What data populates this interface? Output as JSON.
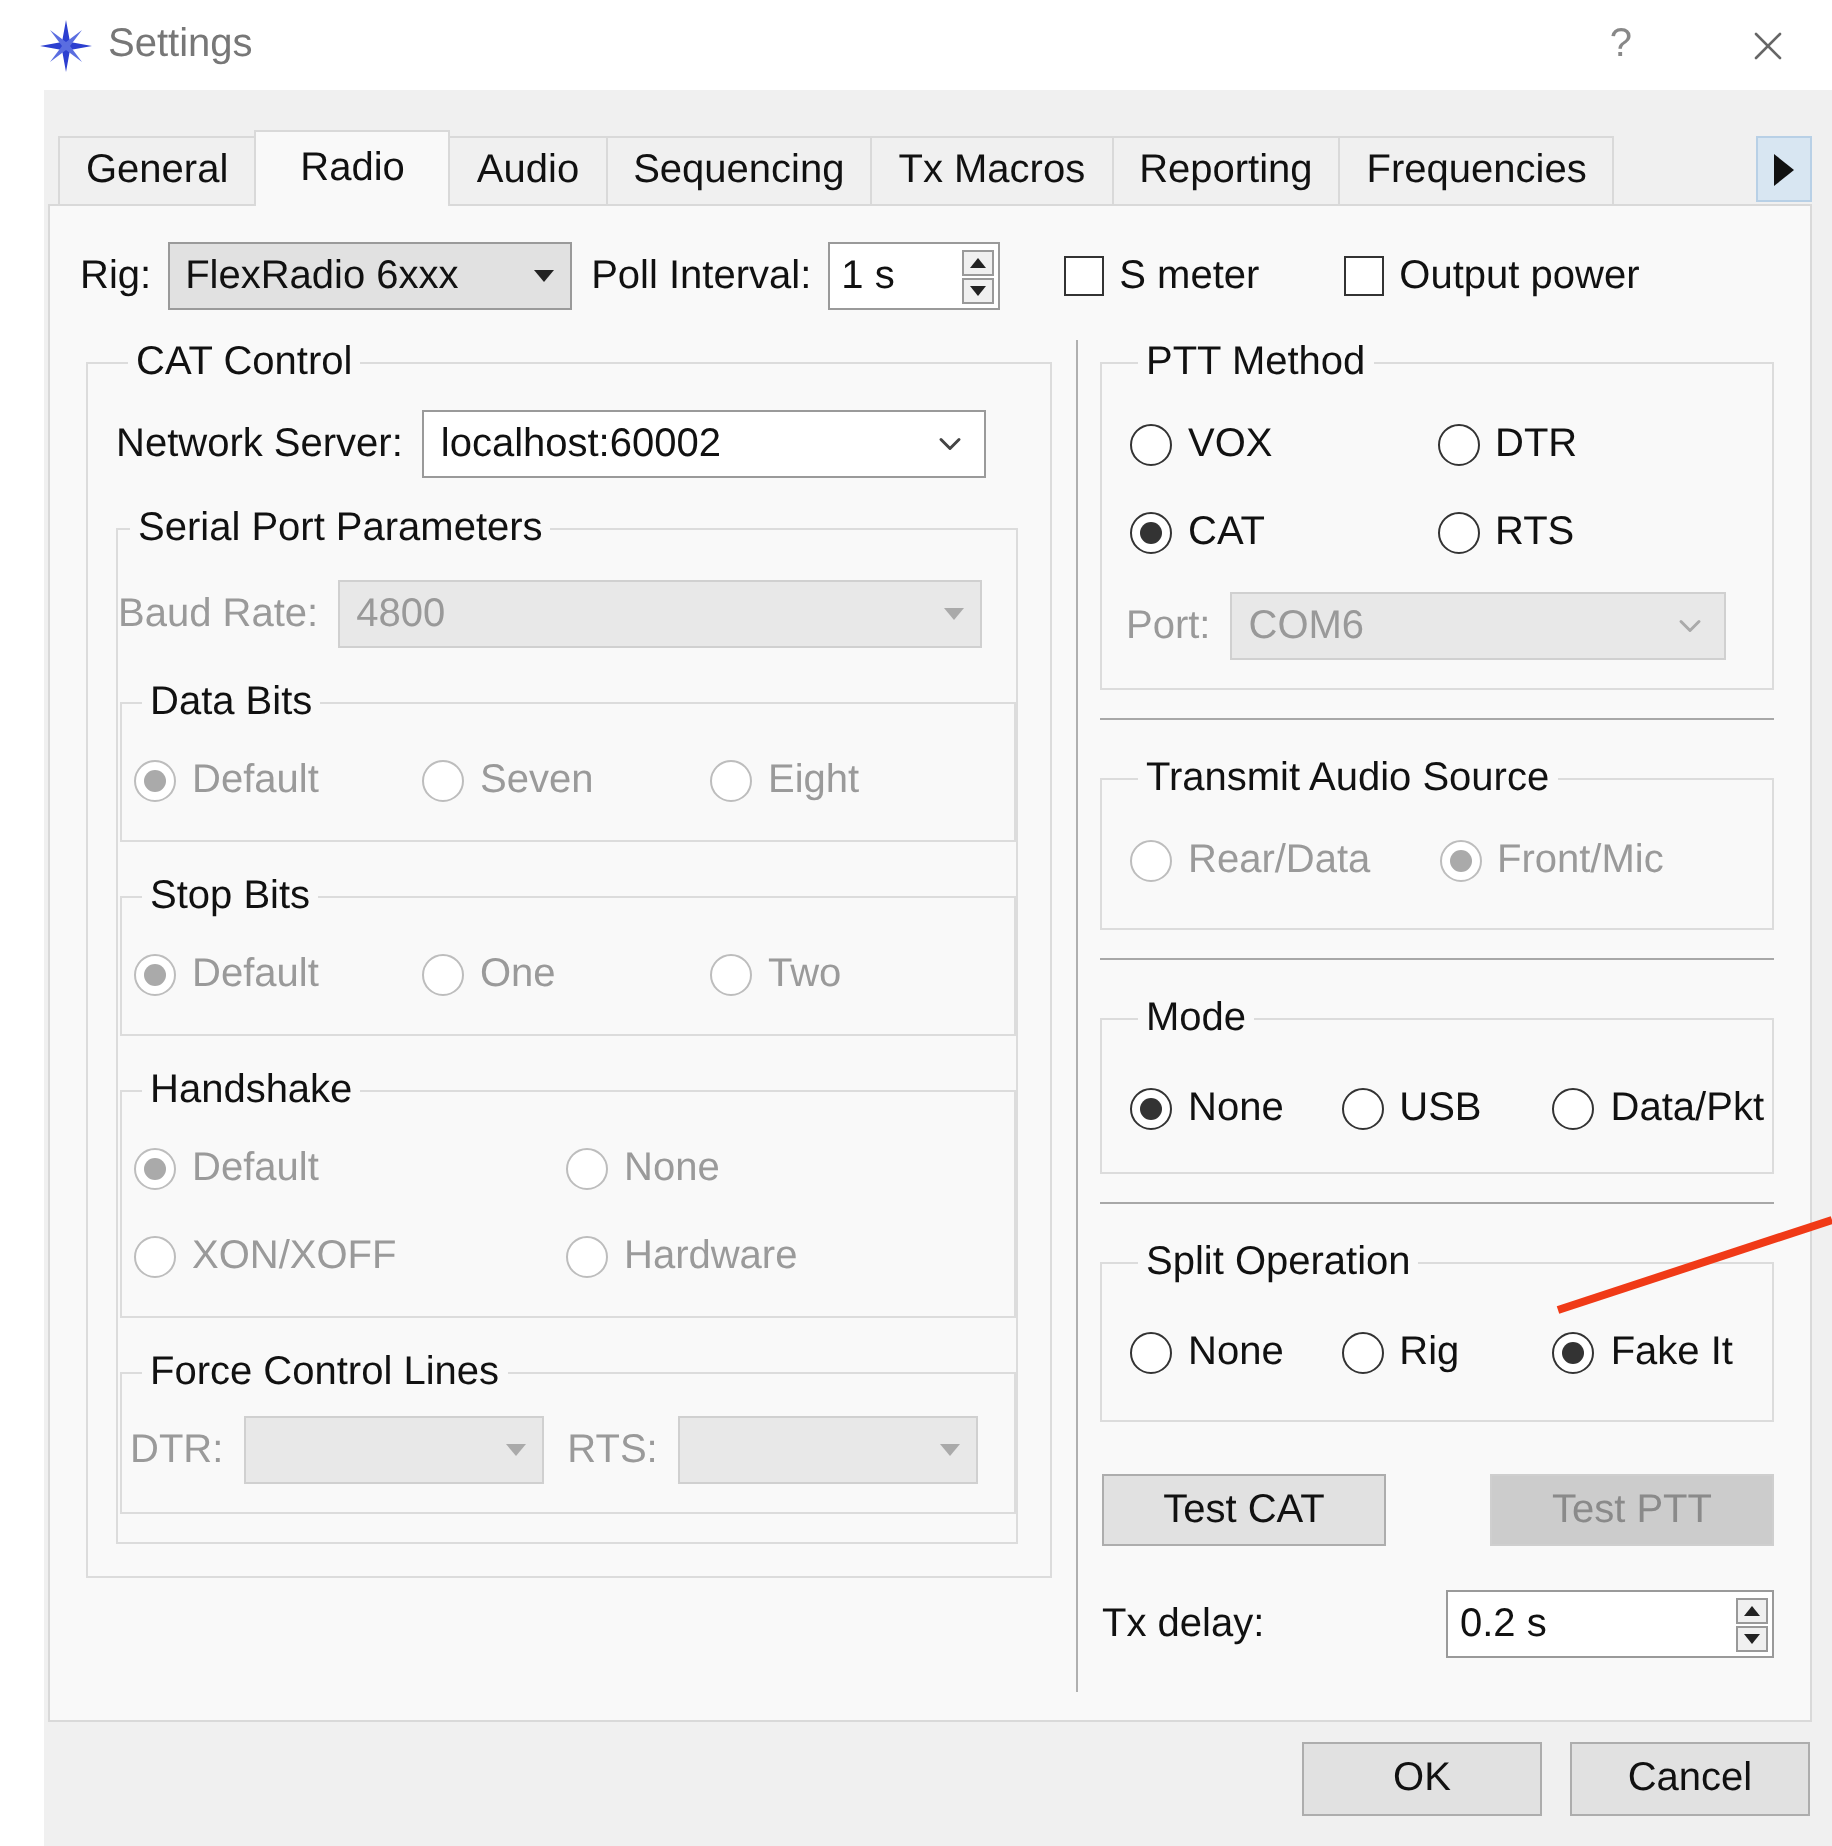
{
  "window": {
    "title": "Settings",
    "help": "?"
  },
  "tabs": [
    {
      "label": "General",
      "selected": false
    },
    {
      "label": "Radio",
      "selected": true
    },
    {
      "label": "Audio",
      "selected": false
    },
    {
      "label": "Sequencing",
      "selected": false
    },
    {
      "label": "Tx Macros",
      "selected": false
    },
    {
      "label": "Reporting",
      "selected": false
    },
    {
      "label": "Frequencies",
      "selected": false
    }
  ],
  "rig": {
    "label": "Rig:",
    "value": "FlexRadio 6xxx"
  },
  "poll_interval": {
    "label": "Poll Interval:",
    "value": "1 s"
  },
  "checkboxes": [
    {
      "label": "S meter",
      "checked": false
    },
    {
      "label": "Output power",
      "checked": false
    }
  ],
  "cat_control": {
    "title": "CAT Control",
    "network_server": {
      "label": "Network Server:",
      "value": "localhost:60002"
    },
    "serial_port": {
      "title": "Serial Port Parameters",
      "baud_rate": {
        "label": "Baud Rate:",
        "value": "4800",
        "disabled": true
      },
      "groups": [
        {
          "title": "Data Bits",
          "disabled": true,
          "rows": [
            [
              {
                "label": "Default",
                "selected": true
              },
              {
                "label": "Seven",
                "selected": false
              },
              {
                "label": "Eight",
                "selected": false
              }
            ]
          ]
        },
        {
          "title": "Stop Bits",
          "disabled": true,
          "rows": [
            [
              {
                "label": "Default",
                "selected": true
              },
              {
                "label": "One",
                "selected": false
              },
              {
                "label": "Two",
                "selected": false
              }
            ]
          ]
        },
        {
          "title": "Handshake",
          "disabled": true,
          "rows": [
            [
              {
                "label": "Default",
                "selected": true
              },
              {
                "label": "None",
                "selected": false
              }
            ],
            [
              {
                "label": "XON/XOFF",
                "selected": false
              },
              {
                "label": "Hardware",
                "selected": false
              }
            ]
          ]
        }
      ],
      "force_control_lines": {
        "title": "Force Control Lines",
        "disabled": true,
        "fields": [
          {
            "label": "DTR:"
          },
          {
            "label": "RTS:"
          }
        ]
      }
    }
  },
  "ptt_method": {
    "title": "PTT Method",
    "disabled": false,
    "rows": [
      [
        {
          "label": "VOX",
          "selected": false
        },
        {
          "label": "DTR",
          "selected": false
        }
      ],
      [
        {
          "label": "CAT",
          "selected": true
        },
        {
          "label": "RTS",
          "selected": false
        }
      ]
    ],
    "port": {
      "label": "Port:",
      "value": "COM6",
      "disabled": true
    }
  },
  "transmit_audio_source": {
    "title": "Transmit Audio Source",
    "disabled": true,
    "rows": [
      [
        {
          "label": "Rear/Data",
          "selected": false
        },
        {
          "label": "Front/Mic",
          "selected": true
        }
      ]
    ]
  },
  "mode": {
    "title": "Mode",
    "disabled": false,
    "rows": [
      [
        {
          "label": "None",
          "selected": true
        },
        {
          "label": "USB",
          "selected": false
        },
        {
          "label": "Data/Pkt",
          "selected": false
        }
      ]
    ]
  },
  "split_operation": {
    "title": "Split Operation",
    "disabled": false,
    "rows": [
      [
        {
          "label": "None",
          "selected": false
        },
        {
          "label": "Rig",
          "selected": false
        },
        {
          "label": "Fake It",
          "selected": true
        }
      ]
    ]
  },
  "test_buttons": [
    {
      "label": "Test CAT",
      "disabled": false
    },
    {
      "label": "Test PTT",
      "disabled": true
    }
  ],
  "tx_delay": {
    "label": "Tx delay:",
    "value": "0.2 s"
  },
  "dialog_buttons": [
    {
      "label": "OK"
    },
    {
      "label": "Cancel"
    }
  ]
}
